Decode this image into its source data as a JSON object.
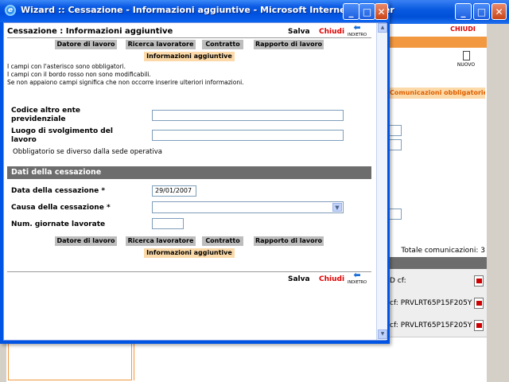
{
  "background_window": {
    "chiudi_label": "CHIUDI",
    "nuovo_label": "NUOVO",
    "tab_label": "Comunicazioni obbligatorie",
    "total_label": "Totale comunicazioni: 3",
    "rows": [
      {
        "text": "D cf:"
      },
      {
        "text": "cf: PRVLRT65P15F205Y"
      },
      {
        "text": "cf: PRVLRT65P15F205Y"
      }
    ]
  },
  "wizard": {
    "window_title": "Wizard :: Cessazione - Informazioni aggiuntive - Microsoft Internet Explorer",
    "page_title": "Cessazione : Informazioni aggiuntive",
    "actions": {
      "salva": "Salva",
      "chiudi": "Chiudi",
      "indietro": "INDIETRO"
    },
    "tabs": [
      {
        "label": "Datore di lavoro",
        "active": false
      },
      {
        "label": "Ricerca lavoratore",
        "active": false
      },
      {
        "label": "Contratto",
        "active": false
      },
      {
        "label": "Rapporto di lavoro",
        "active": false
      },
      {
        "label": "Informazioni aggiuntive",
        "active": true
      }
    ],
    "info_lines": [
      "I campi con l'asterisco sono obbligatori.",
      "I campi con il bordo rosso non sono modificabili.",
      "Se non appaiono campi significa che non occorre inserire ulteriori informazioni."
    ],
    "fields": {
      "codice_altro_ente": {
        "label": "Codice altro ente previdenziale",
        "value": ""
      },
      "luogo_svolgimento": {
        "label": "Luogo di svolgimento del lavoro",
        "value": ""
      },
      "luogo_note": "Obbligatorio se diverso dalla sede operativa"
    },
    "section_title": "Dati della cessazione",
    "cessazione": {
      "data": {
        "label": "Data della cessazione *",
        "value": "29/01/2007"
      },
      "causa": {
        "label": "Causa della cessazione *",
        "value": ""
      },
      "giornate": {
        "label": "Num. giornate lavorate",
        "value": ""
      }
    }
  }
}
